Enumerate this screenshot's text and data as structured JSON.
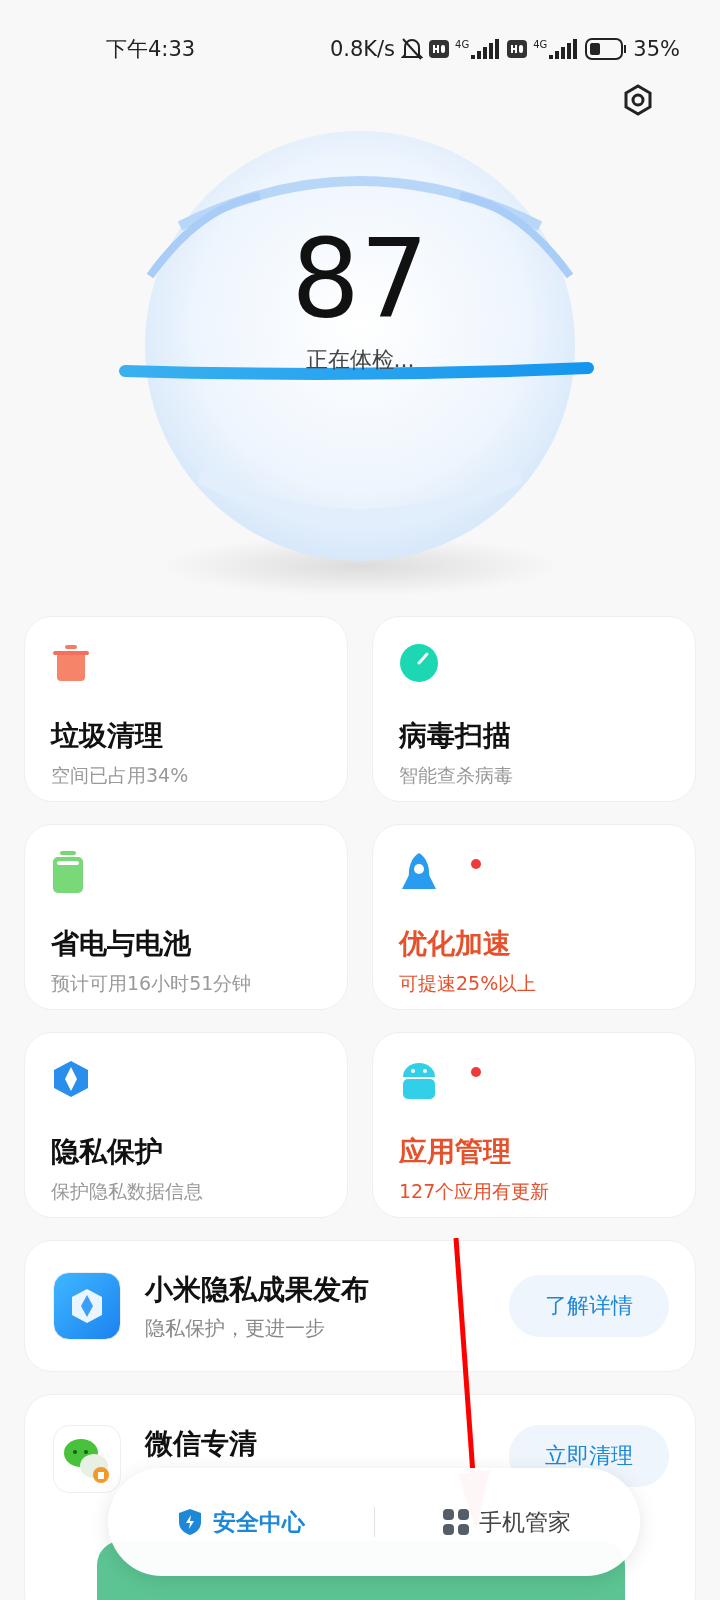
{
  "status_bar": {
    "time": "下午4:33",
    "speed": "0.8K/s",
    "network_1": "4G",
    "network_2": "4G",
    "battery": "35%"
  },
  "score": {
    "value": "87",
    "caption": "正在体检..."
  },
  "tiles": [
    {
      "kind": "trash",
      "title": "垃圾清理",
      "subtitle": "空间已占用34%",
      "alert": false
    },
    {
      "kind": "scan",
      "title": "病毒扫描",
      "subtitle": "智能查杀病毒",
      "alert": false
    },
    {
      "kind": "battery",
      "title": "省电与电池",
      "subtitle": "预计可用16小时51分钟",
      "alert": false
    },
    {
      "kind": "rocket",
      "title": "优化加速",
      "subtitle": "可提速25%以上",
      "alert": true
    },
    {
      "kind": "shield",
      "title": "隐私保护",
      "subtitle": "保护隐私数据信息",
      "alert": false
    },
    {
      "kind": "android",
      "title": "应用管理",
      "subtitle": "127个应用有更新",
      "alert": true
    }
  ],
  "promos": [
    {
      "kind": "privacy",
      "title": "小米隐私成果发布",
      "subtitle": "隐私保护，更进一步",
      "button": "了解详情"
    },
    {
      "kind": "wechat",
      "title": "微信专清",
      "button": "立即清理"
    }
  ],
  "bottom_nav": [
    {
      "label": "安全中心",
      "kind": "shield",
      "selected": true
    },
    {
      "label": "手机管家",
      "kind": "grid",
      "selected": false
    }
  ]
}
